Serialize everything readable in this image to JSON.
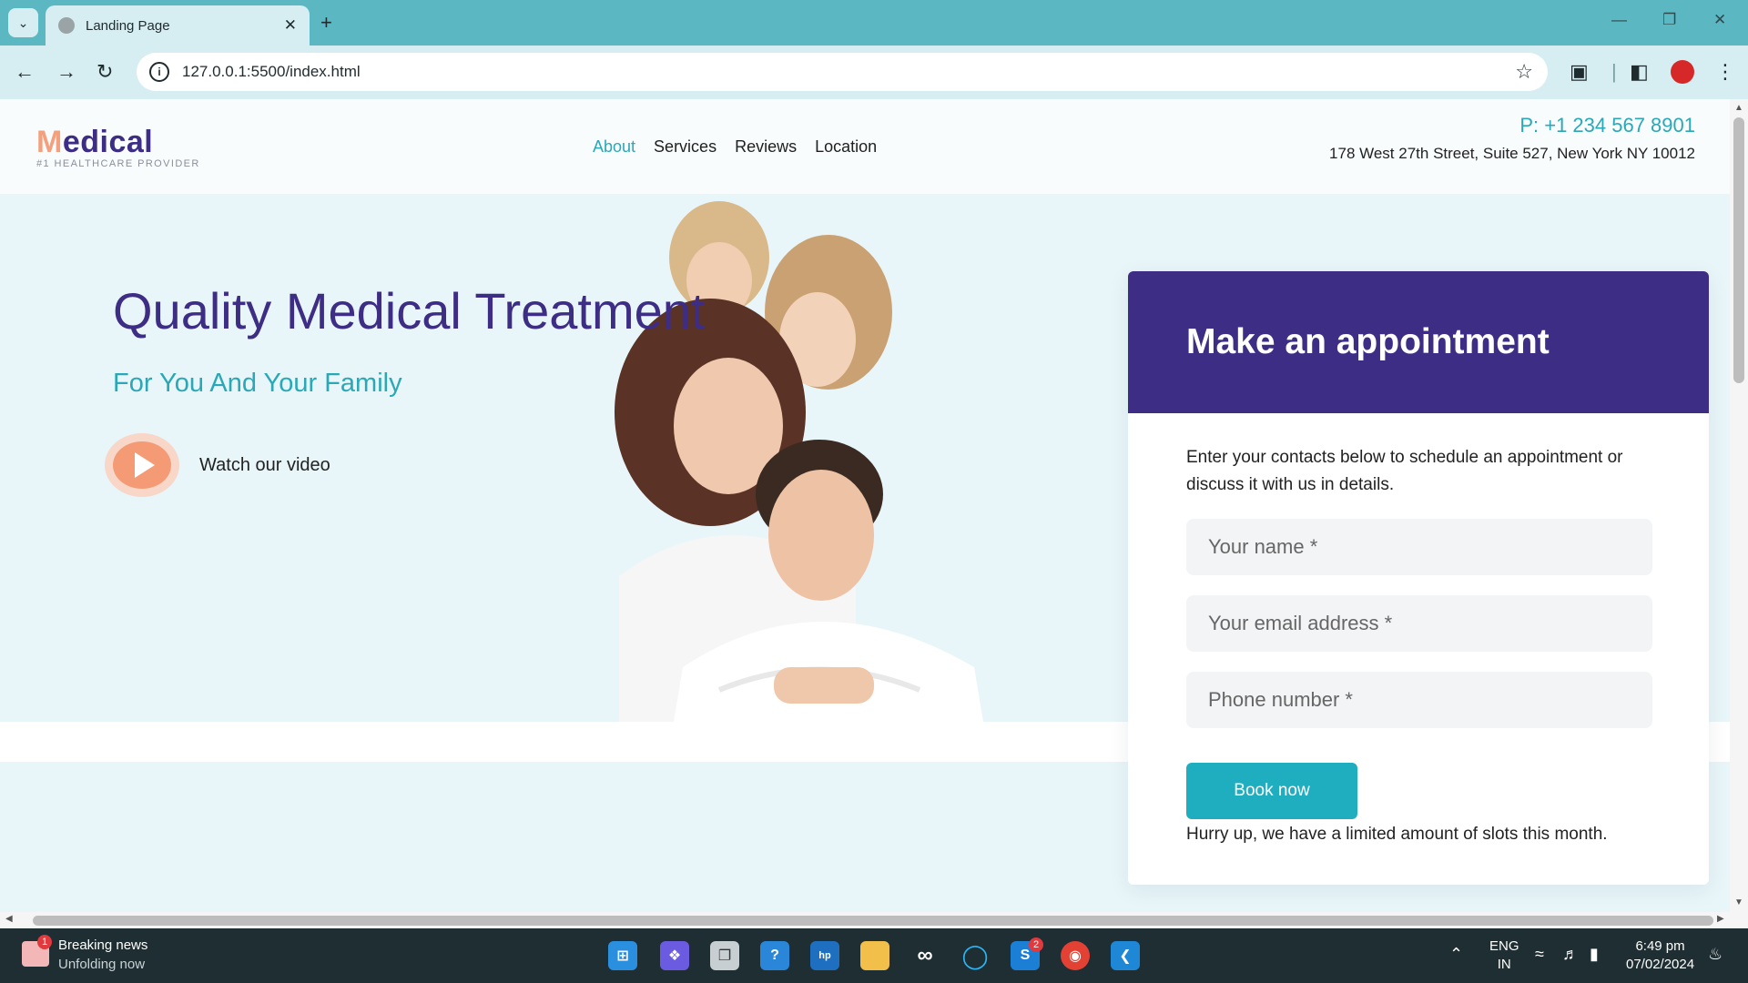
{
  "browser": {
    "tab_title": "Landing Page",
    "url": "127.0.0.1:5500/index.html"
  },
  "site": {
    "logo_first": "M",
    "logo_rest": "edical",
    "logo_tagline": "#1 HEALTHCARE PROVIDER",
    "nav": [
      "About",
      "Services",
      "Reviews",
      "Location"
    ],
    "phone": "P: +1 234 567 8901",
    "address": "178 West 27th Street, Suite 527, New York NY 10012"
  },
  "hero": {
    "title": "Quality Medical Treatment",
    "subtitle": "For You And Your Family",
    "watch_label": "Watch our video"
  },
  "appointment": {
    "title": "Make an appointment",
    "description": "Enter your contacts below to schedule an appointment or discuss it with us in details.",
    "name_placeholder": "Your name *",
    "email_placeholder": "Your email address *",
    "phone_placeholder": "Phone number *",
    "button_label": "Book now",
    "note": "Hurry up, we have a limited amount of slots this month."
  },
  "taskbar": {
    "news_title": "Breaking news",
    "news_subtitle": "Unfolding now",
    "news_badge": "1",
    "skype_badge": "2",
    "lang_line1": "ENG",
    "lang_line2": "IN",
    "time": "6:49 pm",
    "date": "07/02/2024"
  },
  "colors": {
    "brand_purple": "#3d2d85",
    "brand_teal": "#2aa8b7",
    "accent_orange": "#f49b76",
    "hero_bg": "#e8f6f9"
  }
}
